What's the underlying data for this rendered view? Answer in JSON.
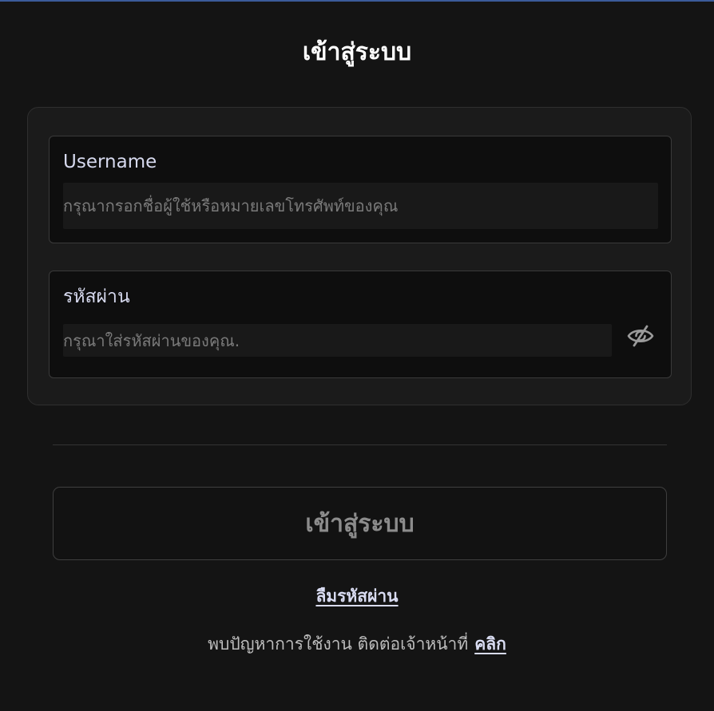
{
  "page": {
    "title": "เข้าสู่ระบบ"
  },
  "form": {
    "username": {
      "label": "Username",
      "value": "",
      "placeholder": "กรุณากรอกชื่อผู้ใช้หรือหมายเลขโทรศัพท์ของคุณ"
    },
    "password": {
      "label": "รหัสผ่าน",
      "value": "",
      "placeholder": "กรุณาใส่รหัสผ่านของคุณ.",
      "toggle_icon": "eye-off-icon"
    }
  },
  "actions": {
    "login_label": "เข้าสู่ระบบ",
    "forgot_password_label": "ลืมรหัสผ่าน"
  },
  "help": {
    "text": "พบปัญหาการใช้งาน ติดต่อเจ้าหน้าที่",
    "link_label": "คลิก"
  },
  "colors": {
    "background": "#141414",
    "card": "#1b1b1b",
    "link": "#d9dcf2",
    "top_accent": "#3b5b9a"
  }
}
